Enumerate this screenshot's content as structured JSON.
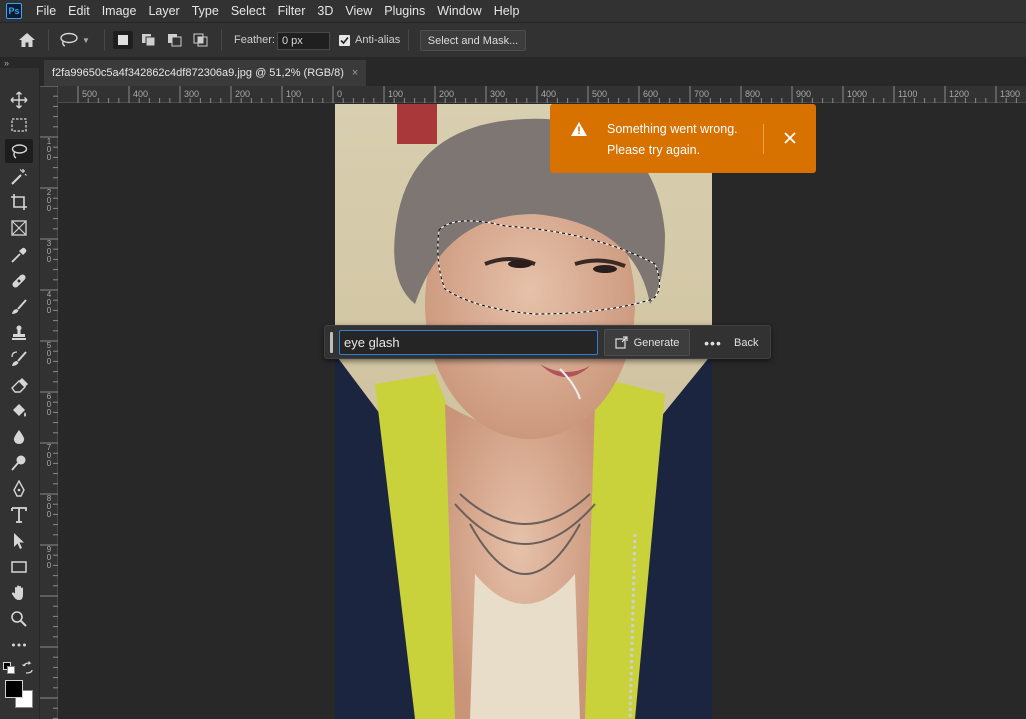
{
  "app": {
    "logo": "Ps"
  },
  "menubar": {
    "items": [
      "File",
      "Edit",
      "Image",
      "Layer",
      "Type",
      "Select",
      "Filter",
      "3D",
      "View",
      "Plugins",
      "Window",
      "Help"
    ]
  },
  "options": {
    "feather_label": "Feather:",
    "feather_value": "0 px",
    "antialias_label": "Anti-alias",
    "antialias_checked": true,
    "select_mask_label": "Select and Mask..."
  },
  "document": {
    "tab_title": "f2fa99650c5a4f342862c4df872306a9.jpg @ 51,2% (RGB/8)",
    "close_glyph": "×"
  },
  "ruler": {
    "top_labels": [
      "500",
      "400",
      "300",
      "200",
      "100",
      "0",
      "100",
      "200",
      "300",
      "400",
      "500",
      "600",
      "700",
      "800",
      "900",
      "1000",
      "1100",
      "1200",
      "1300"
    ],
    "left_labels": [
      "1 0 0",
      "2 0 0",
      "3 0 0",
      "4 0 0",
      "5 0 0",
      "6 0 0",
      "7 0 0",
      "8 0 0",
      "9 0 0"
    ]
  },
  "genfill": {
    "prompt_value": "eye glash",
    "generate_label": "Generate",
    "more_glyph": "•••",
    "back_label": "Back"
  },
  "toast": {
    "line1": "Something went wrong.",
    "line2": "Please try again.",
    "color": "#d77100"
  },
  "colors": {
    "foreground": "#000000",
    "background": "#ffffff"
  }
}
